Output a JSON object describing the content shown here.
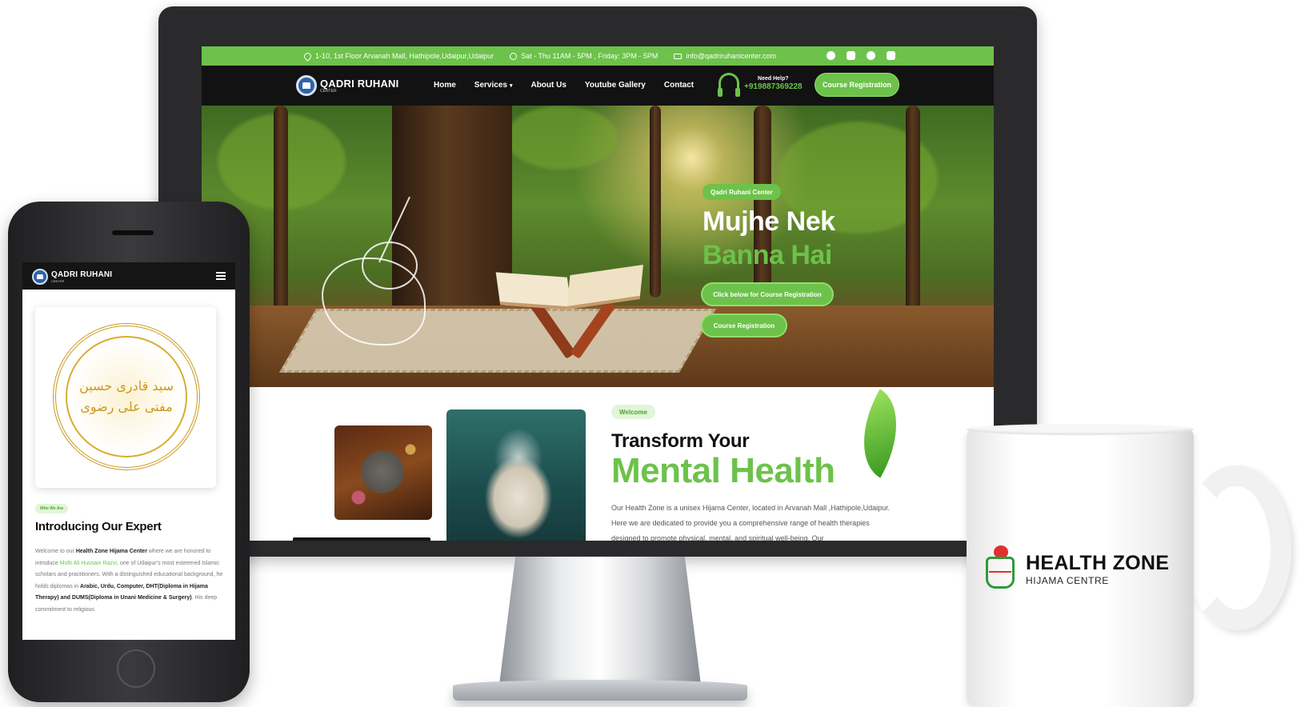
{
  "desktop": {
    "topbar": {
      "address": "1-10, 1st Floor Arvanah Mall, Hathipole,Udaipur,Udaipur",
      "hours": "Sat - Thu 11AM - 5PM , Friday: 3PM - 5PM",
      "email": "info@qadriruhanicenter.com",
      "socials": [
        "facebook-icon",
        "youtube-icon",
        "whatsapp-icon",
        "instagram-icon"
      ]
    },
    "nav": {
      "logo_title": "QADRI RUHANI",
      "logo_sub": "CENTER",
      "links": [
        "Home",
        "Services",
        "About Us",
        "Youtube Gallery",
        "Contact"
      ],
      "help_label": "Need Help?",
      "help_phone": "+919887369228",
      "cta": "Course Registration"
    },
    "hero": {
      "badge": "Qadri Ruhani Center",
      "title_line1": "Mujhe Nek",
      "title_line2": "Banna Hai",
      "button_primary": "Click below for Course Registration",
      "button_secondary": "Course Registration"
    },
    "welcome": {
      "badge": "Welcome",
      "title_line1": "Transform Your",
      "title_line2": "Mental Health",
      "text": "Our Health Zone is a unisex Hijama Center, located in Arvanah Mall ,Hathipole,Udaipur. Here we are dedicated to provide you a comprehensive range of health therapies designed to promote physical, mental, and spiritual well-being. Our"
    }
  },
  "mobile": {
    "logo_title": "QADRI RUHANI",
    "logo_sub": "CENTER",
    "badge": "Who We Are",
    "title": "Introducing Our Expert",
    "text_1": "Welcome to our ",
    "text_bold_1": "Health Zone Hijama Center",
    "text_2": " where we are honored to introduce ",
    "text_green": "Mufti Ali Hussain Razvi",
    "text_3": ", one of Udaipur's most esteemed Islamic scholars and practitioners. With a distinguished educational background, he holds diplomas in ",
    "text_bold_2": "Arabic, Urdu, Computer, DHT(Diploma in Hijama Therapy) and DUMS(Diploma in Unani Medicine & Surgery)",
    "text_4": ". His deep commitment to religious",
    "seal_text": "سید قادری حسین مفتی علی رضوی"
  },
  "mug": {
    "brand": "HEALTH ZONE",
    "tagline": "HIJAMA CENTRE"
  },
  "colors": {
    "accent": "#6cc24a",
    "dark": "#121212",
    "gold": "#c99a1d"
  }
}
